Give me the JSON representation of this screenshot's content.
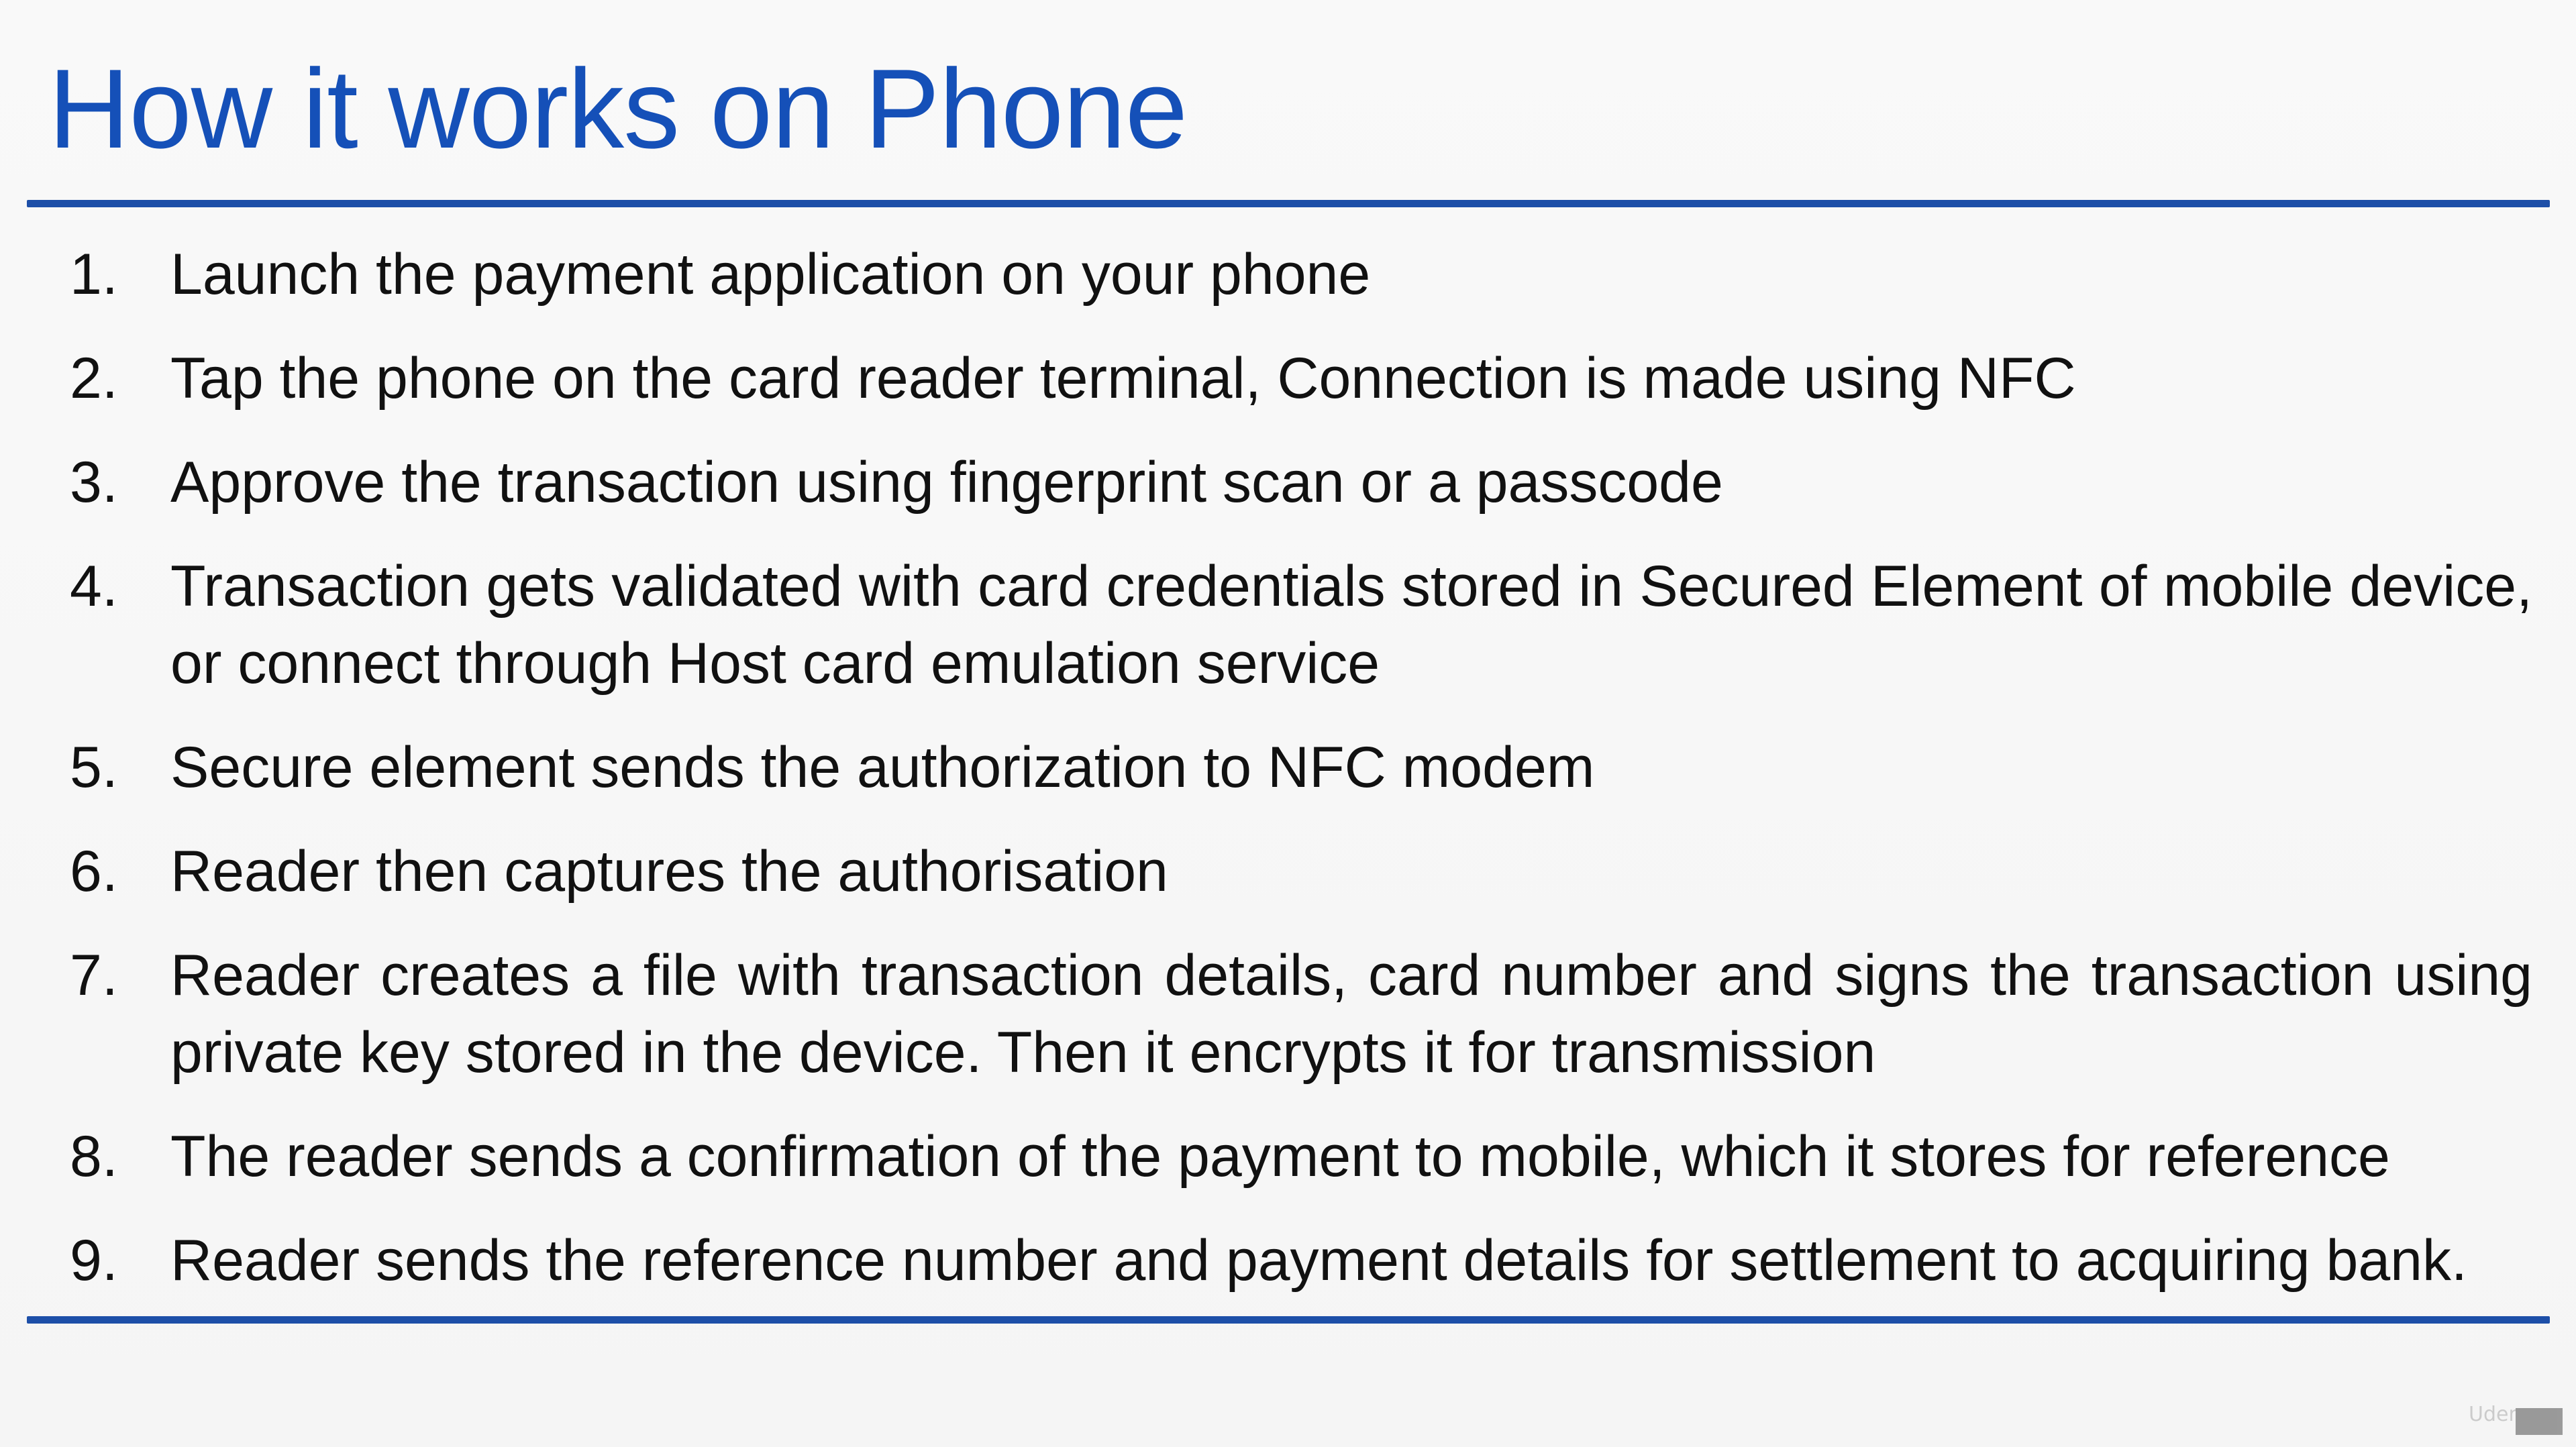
{
  "slide": {
    "title": "How it works on Phone",
    "steps": [
      {
        "number": "1.",
        "text": "Launch the payment application on your phone"
      },
      {
        "number": "2.",
        "text": "Tap the phone on the card reader terminal, Connection is made using NFC"
      },
      {
        "number": "3.",
        "text": "Approve the transaction using fingerprint scan or a passcode"
      },
      {
        "number": "4.",
        "text": "Transaction gets validated with card credentials stored in Secured Element of mobile device, or connect through Host card emulation service"
      },
      {
        "number": "5.",
        "text": "Secure element sends the authorization to NFC modem"
      },
      {
        "number": "6.",
        "text": "Reader then captures the authorisation"
      },
      {
        "number": "7.",
        "text": "Reader creates a file with transaction details, card number and signs the transaction using private key stored in the device. Then it encrypts it for transmission"
      },
      {
        "number": "8.",
        "text": "The reader sends a confirmation of the payment to mobile, which it stores for reference"
      },
      {
        "number": "9.",
        "text": "Reader sends the reference number and payment details for settlement to acquiring bank."
      }
    ],
    "watermark": {
      "icon": "udemy-logo-icon",
      "text": "Udemy"
    },
    "colors": {
      "title": "#1550b8",
      "rule": "#1d4fa8",
      "text": "#111111",
      "background": "#f7f7f7"
    }
  }
}
